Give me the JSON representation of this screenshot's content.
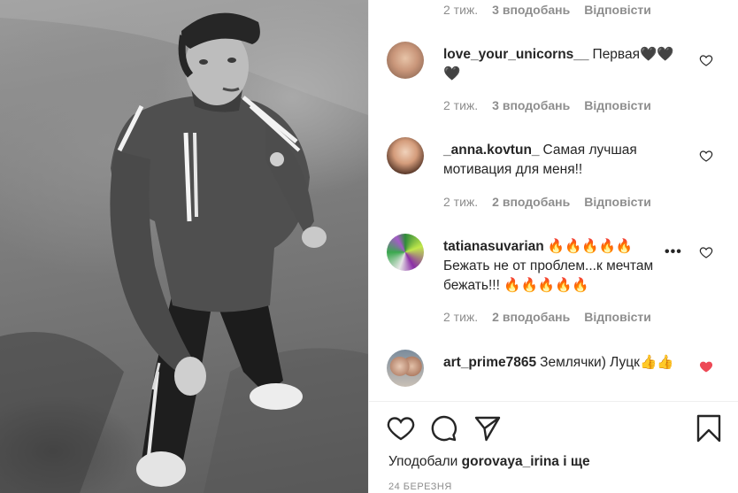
{
  "photo": {
    "alt": ""
  },
  "top_meta": {
    "time": "2 тиж.",
    "likes": "3 вподобань",
    "reply": "Відповісти"
  },
  "comments": [
    {
      "user": "love_your_unicorns__",
      "text": "Первая🖤🖤🖤",
      "time": "2 тиж.",
      "likes": "3 вподобань",
      "reply": "Відповісти",
      "liked": false
    },
    {
      "user": "_anna.kovtun_",
      "text": "Самая лучшая мотивация для меня!!",
      "time": "2 тиж.",
      "likes": "2 вподобань",
      "reply": "Відповісти",
      "liked": false
    },
    {
      "user": "tatianasuvarian",
      "text": "🔥🔥🔥🔥🔥 Бежать не от проблем...к мечтам бежать!!! 🔥🔥🔥🔥🔥",
      "time": "2 тиж.",
      "likes": "2 вподобань",
      "reply": "Відповісти",
      "liked": false,
      "more": "•••"
    },
    {
      "user": "art_prime7865",
      "text": "Землячки) Луцк👍👍",
      "liked": true
    }
  ],
  "footer": {
    "liked_by_prefix": "Уподобали",
    "liked_by_user": "gorovaya_irina",
    "liked_by_suffix": "і ще",
    "date": "24 БЕРЕЗНЯ"
  },
  "colors": {
    "liked_heart": "#ed4956",
    "muted": "#8e8e8e",
    "text": "#262626"
  }
}
